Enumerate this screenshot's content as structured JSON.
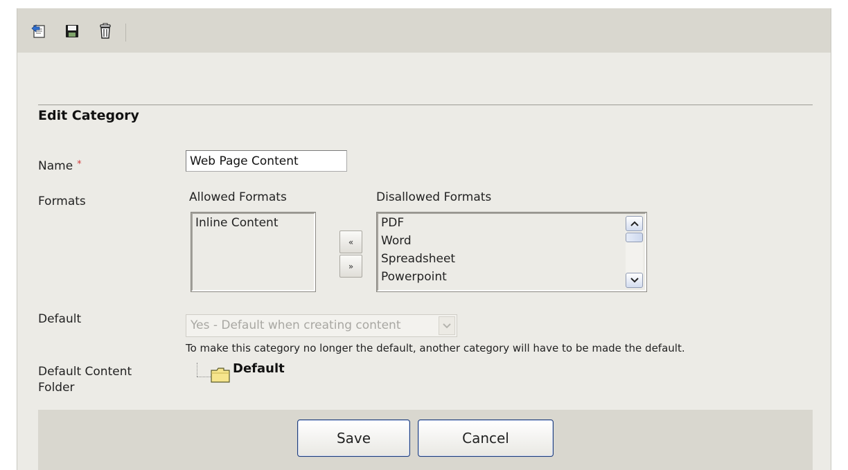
{
  "toolbar": {
    "buttons": [
      {
        "icon": "back-icon",
        "label": ""
      },
      {
        "icon": "save-disk-icon",
        "label": ""
      },
      {
        "icon": "trash-icon",
        "label": ""
      }
    ]
  },
  "form": {
    "title": "Edit Category",
    "name": {
      "label": "Name",
      "required_mark": "*",
      "value": "Web Page Content"
    },
    "formats": {
      "label": "Formats",
      "allowed_header": "Allowed Formats",
      "disallowed_header": "Disallowed Formats",
      "allowed": [
        "Inline Content"
      ],
      "disallowed": [
        "PDF",
        "Word",
        "Spreadsheet",
        "Powerpoint"
      ],
      "move_left": "«",
      "move_right": "»"
    },
    "default": {
      "label": "Default",
      "selected": "Yes - Default when creating content",
      "note": "To make this category no longer the default, another category will have to be made the default."
    },
    "folder": {
      "label_line1": "Default Content",
      "label_line2": "Folder",
      "value": "Default"
    }
  },
  "actions": {
    "save": "Save",
    "cancel": "Cancel"
  },
  "colors": {
    "panel": "#ecebe6",
    "toolbar": "#d9d7cf",
    "required": "#d23b3b",
    "button_border": "#1f3d7a"
  }
}
